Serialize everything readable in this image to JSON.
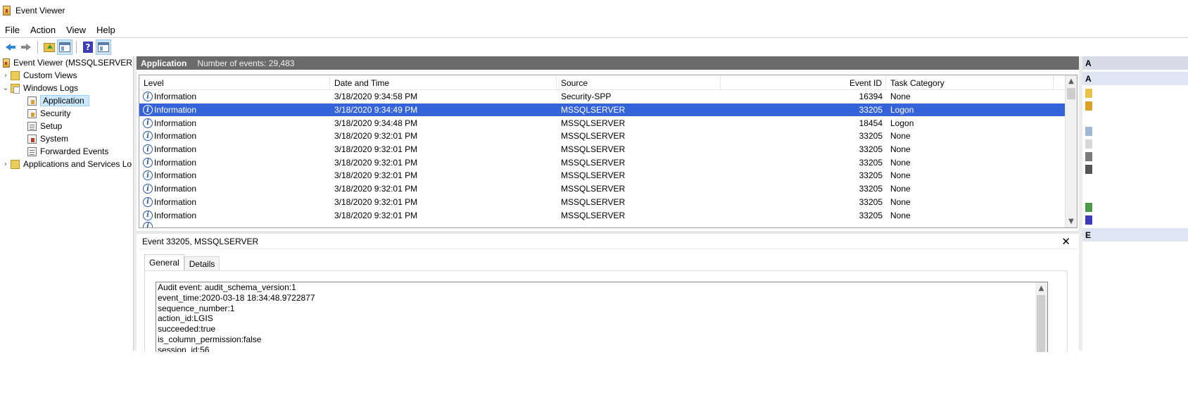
{
  "window": {
    "title": "Event Viewer"
  },
  "menu": [
    "File",
    "Action",
    "View",
    "Help"
  ],
  "toolbar": {
    "buttons": [
      "back-icon",
      "forward-icon",
      "up-folder-icon",
      "show-hide-console-tree-icon",
      "help-icon",
      "show-hide-action-pane-icon"
    ]
  },
  "tree": {
    "root": "Event Viewer (MSSQLSERVER.LO",
    "custom_views": "Custom Views",
    "windows_logs": "Windows Logs",
    "logs": [
      "Application",
      "Security",
      "Setup",
      "System",
      "Forwarded Events"
    ],
    "selected": "Application",
    "apps_services": "Applications and Services Lo"
  },
  "log_header": {
    "title": "Application",
    "count_text": "Number of events: 29,483"
  },
  "grid": {
    "columns": [
      "Level",
      "Date and Time",
      "Source",
      "Event ID",
      "Task Category"
    ],
    "rows": [
      {
        "level": "Information",
        "date": "3/18/2020 9:34:58 PM",
        "source": "Security-SPP",
        "event_id": "16394",
        "task": "None"
      },
      {
        "level": "Information",
        "date": "3/18/2020 9:34:49 PM",
        "source": "MSSQLSERVER",
        "event_id": "33205",
        "task": "Logon"
      },
      {
        "level": "Information",
        "date": "3/18/2020 9:34:48 PM",
        "source": "MSSQLSERVER",
        "event_id": "18454",
        "task": "Logon"
      },
      {
        "level": "Information",
        "date": "3/18/2020 9:32:01 PM",
        "source": "MSSQLSERVER",
        "event_id": "33205",
        "task": "None"
      },
      {
        "level": "Information",
        "date": "3/18/2020 9:32:01 PM",
        "source": "MSSQLSERVER",
        "event_id": "33205",
        "task": "None"
      },
      {
        "level": "Information",
        "date": "3/18/2020 9:32:01 PM",
        "source": "MSSQLSERVER",
        "event_id": "33205",
        "task": "None"
      },
      {
        "level": "Information",
        "date": "3/18/2020 9:32:01 PM",
        "source": "MSSQLSERVER",
        "event_id": "33205",
        "task": "None"
      },
      {
        "level": "Information",
        "date": "3/18/2020 9:32:01 PM",
        "source": "MSSQLSERVER",
        "event_id": "33205",
        "task": "None"
      },
      {
        "level": "Information",
        "date": "3/18/2020 9:32:01 PM",
        "source": "MSSQLSERVER",
        "event_id": "33205",
        "task": "None"
      },
      {
        "level": "Information",
        "date": "3/18/2020 9:32:01 PM",
        "source": "MSSQLSERVER",
        "event_id": "33205",
        "task": "None"
      }
    ],
    "selected_index": 1
  },
  "detail": {
    "title": "Event 33205, MSSQLSERVER",
    "tabs": [
      "General",
      "Details"
    ],
    "active_tab": "General",
    "lines": [
      "Audit event: audit_schema_version:1",
      "event_time:2020-03-18 18:34:48.9722877",
      "sequence_number:1",
      "action_id:LGIS",
      "succeeded:true",
      "is_column_permission:false",
      "session_id:56"
    ]
  },
  "actions_pane": {
    "header": "A",
    "sub_header": "A",
    "lower_header": "E"
  },
  "colors": {
    "selection": "#3563d9",
    "header_bar": "#6b6b6b",
    "info_icon": "#2a5aa8"
  }
}
